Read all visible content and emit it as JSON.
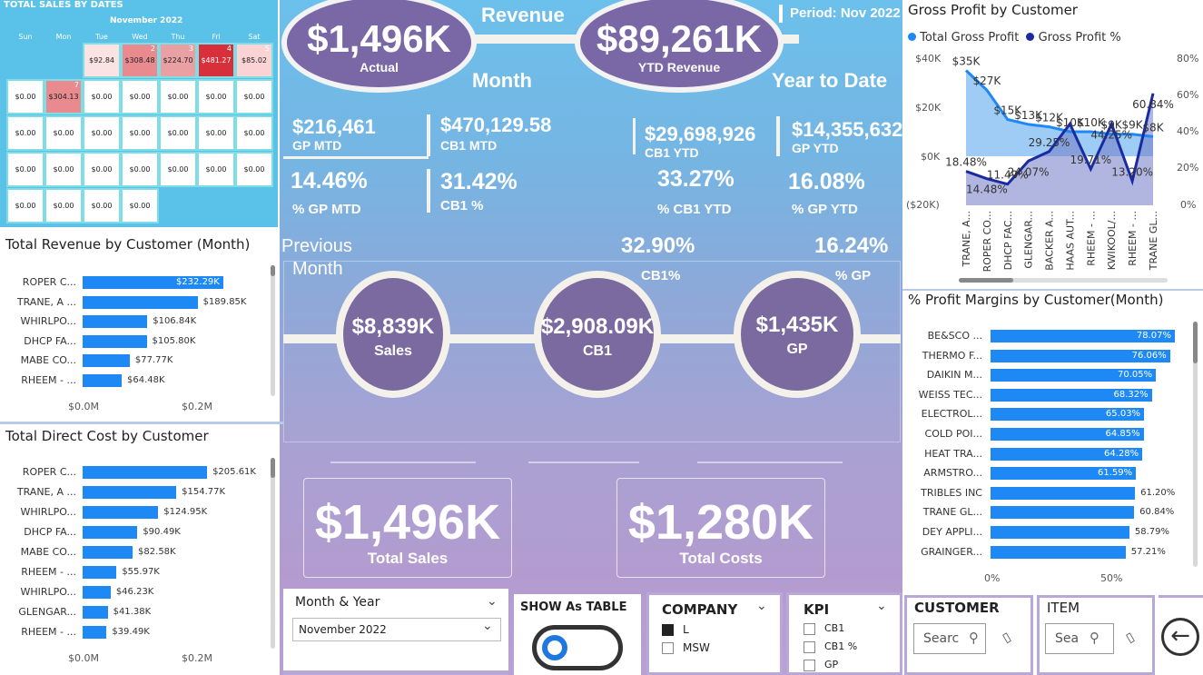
{
  "calendar": {
    "title": "TOTAL SALES BY DATES",
    "month": "November 2022",
    "weekdays": [
      "Sun",
      "Mon",
      "Tue",
      "Wed",
      "Thu",
      "Fri",
      "Sat"
    ],
    "row1": [
      {
        "day": "",
        "value": "$92.84"
      },
      {
        "day": "2",
        "value": "$308.48"
      },
      {
        "day": "3",
        "value": "$224.70"
      },
      {
        "day": "4",
        "value": "$481.27"
      },
      {
        "day": "5",
        "value": "$85.02"
      }
    ],
    "row2": [
      "$0.00",
      "$304.13",
      "$0.00",
      "$0.00",
      "$0.00",
      "$0.00",
      "$0.00"
    ],
    "row2_day": "7",
    "row3": [
      "$0.00",
      "$0.00",
      "$0.00",
      "$0.00",
      "$0.00",
      "$0.00",
      "$0.00"
    ],
    "row4": [
      "$0.00",
      "$0.00",
      "$0.00",
      "$0.00",
      "$0.00",
      "$0.00",
      "$0.00"
    ],
    "row5": [
      "$0.00",
      "$0.00",
      "$0.00",
      "$0.00"
    ]
  },
  "header": {
    "revenue_label": "Revenue",
    "month_label": "Month",
    "ytd_label": "Year to Date",
    "period": "Period: Nov 2022",
    "actual_value": "$1,496K",
    "actual_label": "Actual",
    "ytd_value": "$89,261K",
    "ytd_value_label": "YTD Revenue"
  },
  "kpis": {
    "gp_mtd": "$216,461",
    "gp_mtd_label": "GP MTD",
    "cb1_mtd": "$470,129.58",
    "cb1_mtd_label": "CB1 MTD",
    "cb1_ytd": "$29,698,926",
    "cb1_ytd_label": "CB1 YTD",
    "gp_ytd": "$14,355,632",
    "gp_ytd_label": "GP YTD",
    "pct_gp_mtd": "14.46%",
    "pct_gp_mtd_label": "% GP MTD",
    "cb1_pct": "31.42%",
    "cb1_pct_label": "CB1 %",
    "pct_cb1_ytd": "33.27%",
    "pct_cb1_ytd_label": "% CB1 YTD",
    "pct_gp_ytd": "16.08%",
    "pct_gp_ytd_label": "% GP YTD"
  },
  "previous": {
    "label1": "Previous",
    "label2": "Month",
    "cb1_pct": "32.90%",
    "cb1_pct_label": "CB1%",
    "gp_pct": "16.24%",
    "gp_pct_label": "% GP",
    "sales": "$8,839K",
    "sales_label": "Sales",
    "cb1": "$2,908.09K",
    "cb1_label": "CB1",
    "gp": "$1,435K",
    "gp_label": "GP"
  },
  "totals": {
    "sales": "$1,496K",
    "sales_label": "Total Sales",
    "costs": "$1,280K",
    "costs_label": "Total Costs"
  },
  "revenue_chart": {
    "title": "Total Revenue by Customer (Month)",
    "axis": [
      "$0.0M",
      "$0.2M"
    ]
  },
  "cost_chart": {
    "title": "Total Direct Cost by Customer",
    "axis": [
      "$0.0M",
      "$0.2M"
    ]
  },
  "gp_chart": {
    "title": "Gross Profit by Customer",
    "legend": [
      "Total Gross Profit",
      "Gross Profit %"
    ],
    "left_axis": [
      "$40K",
      "$20K",
      "$0K",
      "($20K)"
    ],
    "right_axis": [
      "80%",
      "60%",
      "40%",
      "20%",
      "0%"
    ]
  },
  "margin_chart": {
    "title": "% Profit Margins by Customer(Month)",
    "axis": [
      "0%",
      "50%"
    ]
  },
  "slicers": {
    "month_year_label": "Month & Year",
    "month_year_value": "November 2022",
    "show_table_label": "SHOW As TABLE",
    "company_label": "COMPANY",
    "company_options": [
      "L",
      "MSW"
    ],
    "kpi_label": "KPI",
    "kpi_options": [
      "CB1",
      "CB1 %",
      "GP"
    ],
    "customer_label": "CUSTOMER",
    "customer_placeholder": "Searc",
    "item_label": "ITEM",
    "item_placeholder": "Sea"
  },
  "chart_data": [
    {
      "type": "bar",
      "title": "Total Revenue by Customer (Month)",
      "categories": [
        "ROPER C...",
        "TRANE, A ...",
        "WHIRLPO...",
        "DHCP FA...",
        "MABE CO...",
        "RHEEM - ..."
      ],
      "values": [
        232.29,
        189.85,
        106.84,
        105.8,
        77.77,
        64.48
      ],
      "labels": [
        "$232.29K",
        "$189.85K",
        "$106.84K",
        "$105.80K",
        "$77.77K",
        "$64.48K"
      ],
      "units": "K",
      "xlim": [
        0,
        270
      ]
    },
    {
      "type": "bar",
      "title": "Total Direct Cost by Customer",
      "categories": [
        "ROPER C...",
        "TRANE, A ...",
        "WHIRLPO...",
        "DHCP FA...",
        "MABE CO...",
        "RHEEM - ...",
        "WHIRLPO...",
        "GLENGAR...",
        "RHEEM - ..."
      ],
      "values": [
        205.61,
        154.77,
        124.95,
        90.49,
        82.58,
        55.97,
        46.23,
        41.38,
        39.49
      ],
      "labels": [
        "$205.61K",
        "$154.77K",
        "$124.95K",
        "$90.49K",
        "$82.58K",
        "$55.97K",
        "$46.23K",
        "$41.38K",
        "$39.49K"
      ],
      "units": "K",
      "xlim": [
        0,
        270
      ]
    },
    {
      "type": "line",
      "title": "Gross Profit by Customer",
      "categories": [
        "TRANE, A...",
        "ROPER CO...",
        "DHCP FAC...",
        "GLENGAR...",
        "BACKER A...",
        "HAAS AUT...",
        "RHEEM - ...",
        "KWIKOOL/...",
        "RHEEM - ...",
        "TRANE GL..."
      ],
      "series": [
        {
          "name": "Total Gross Profit",
          "values": [
            35,
            27,
            15,
            13,
            12,
            10,
            10,
            9,
            9,
            8
          ],
          "labels": [
            "$35K",
            "$27K",
            "$15K",
            "$13K",
            "$12K",
            "$10K",
            "$10K",
            "$9K",
            "$9K",
            "$8K"
          ]
        },
        {
          "name": "Gross Profit %",
          "values": [
            18.48,
            14.48,
            11.49,
            24.07,
            29.25,
            44.25,
            19.71,
            44.25,
            13.2,
            60.84
          ],
          "labels": [
            "18.48%",
            "14.48%",
            "11.49%",
            "24.07%",
            "29.25%",
            "",
            "19.71%",
            "44.25%",
            "13.20%",
            "60.84%"
          ]
        }
      ],
      "ylim_left": [
        -20,
        40
      ],
      "ylim_right": [
        0,
        80
      ]
    },
    {
      "type": "bar",
      "title": "% Profit Margins by Customer(Month)",
      "categories": [
        "BE&SCO ...",
        "THERMO F...",
        "DAIKIN M...",
        "WEISS TEC...",
        "ELECTROL...",
        "COLD POI...",
        "HEAT TRA...",
        "ARMSTRO...",
        "TRIBLES INC",
        "TRANE GL...",
        "DEY APPLI...",
        "GRAINGER..."
      ],
      "values": [
        78.07,
        76.06,
        70.05,
        68.32,
        65.03,
        64.85,
        64.28,
        61.59,
        61.2,
        60.84,
        58.79,
        57.21
      ],
      "labels": [
        "78.07%",
        "76.06%",
        "70.05%",
        "68.32%",
        "65.03%",
        "64.85%",
        "64.28%",
        "61.59%",
        "61.20%",
        "60.84%",
        "58.79%",
        "57.21%"
      ],
      "xlim": [
        0,
        100
      ]
    }
  ]
}
